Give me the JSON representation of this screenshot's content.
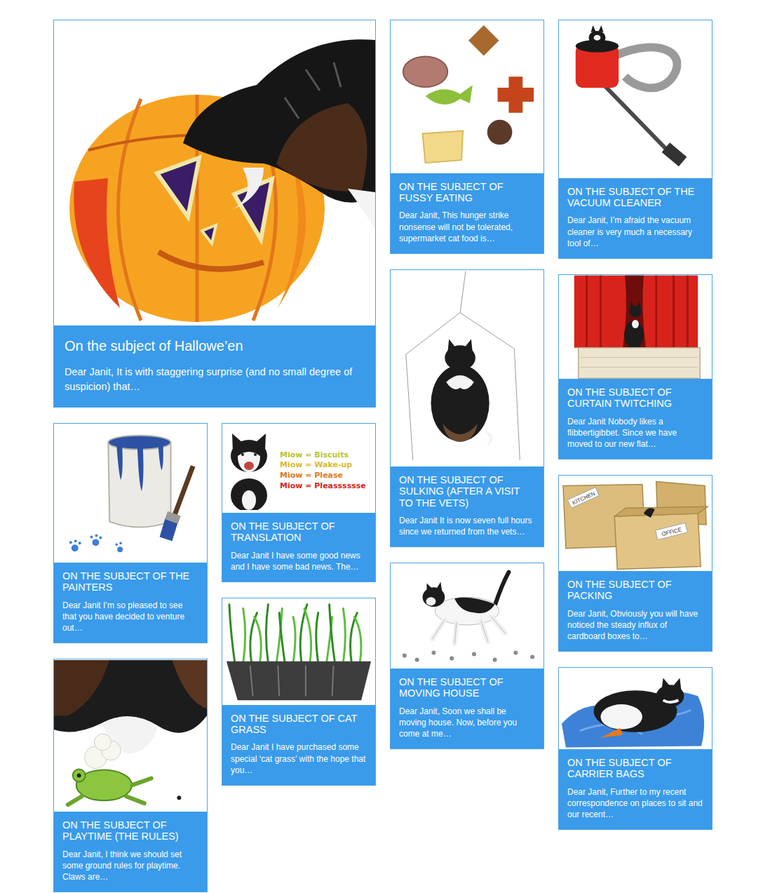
{
  "cards": [
    {
      "kind": "feature",
      "title": "On the subject of Hallowe’en",
      "excerpt": "Dear Janit, It is with staggering surprise (and no small degree of suspicion) that…"
    },
    {
      "kind": "tile",
      "title": "ON THE SUBJECT OF FUSSY EATING",
      "excerpt": "Dear Janit, This hunger strike nonsense will not be tolerated, supermarket cat food is…"
    },
    {
      "kind": "tile",
      "title": "ON THE SUBJECT OF THE VACUUM CLEANER",
      "excerpt": "Dear Janit, I’m afraid the vacuum cleaner is very much a necessary tool of…"
    },
    {
      "kind": "tile",
      "title": "ON THE SUBJECT OF SULKING (AFTER A VISIT TO THE VETS)",
      "excerpt": "Dear Janit It is now seven full hours since we returned from the vets…"
    },
    {
      "kind": "tile",
      "title": "ON THE SUBJECT OF CURTAIN TWITCHING",
      "excerpt": "Dear Janit Nobody likes a flibbertigibbet. Since we have moved to our new flat…"
    },
    {
      "kind": "tile",
      "title": "ON THE SUBJECT OF THE PAINTERS",
      "excerpt": "Dear Janit I’m so pleased to see that you have decided to venture out…"
    },
    {
      "kind": "tile",
      "title": "ON THE SUBJECT OF TRANSLATION",
      "excerpt": "Dear Janit I have some good news and I have some bad news. The…",
      "picture_lines": [
        {
          "text": "Miow = Biscuits",
          "color": "#b5c42c"
        },
        {
          "text": "Miow = Wake-up",
          "color": "#d9b92e"
        },
        {
          "text": "Miow = Please",
          "color": "#e0781c"
        },
        {
          "text": "Miow = Pleasssssse",
          "color": "#d0261c"
        }
      ]
    },
    {
      "kind": "tile",
      "title": "ON THE SUBJECT OF PACKING",
      "excerpt": "Dear Janit, Obviously you will have noticed the steady influx of cardboard boxes to…",
      "picture_labels": [
        "KITCHEN",
        "OFFICE"
      ]
    },
    {
      "kind": "tile",
      "title": "ON THE SUBJECT OF MOVING HOUSE",
      "excerpt": "Dear Janit, Soon we shall be moving house. Now, before you come at me…"
    },
    {
      "kind": "tile",
      "title": "ON THE SUBJECT OF CAT GRASS",
      "excerpt": "Dear Janit I have purchased some special ‘cat grass’ with the hope that you…"
    },
    {
      "kind": "tile",
      "title": "ON THE SUBJECT OF PLAYTIME (THE RULES)",
      "excerpt": "Dear Janit, I think we should set some ground rules for playtime. Claws are…"
    },
    {
      "kind": "tile",
      "title": "ON THE SUBJECT OF CARRIER BAGS",
      "excerpt": "Dear Janit, Further to my recent correspondence on places to sit and our recent…"
    }
  ]
}
